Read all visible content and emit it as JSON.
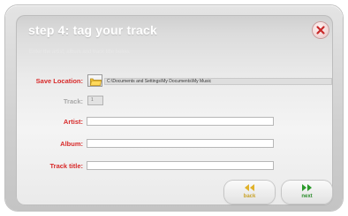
{
  "title": "step 4: tag your track",
  "subtitle": "Enter the artist, album and track title below.",
  "save_location": {
    "label": "Save Location:",
    "path": "C:\\Documents and Settings\\My Documents\\My Music"
  },
  "track": {
    "label": "Track:",
    "value": "1"
  },
  "fields": {
    "artist": {
      "label": "Artist:",
      "value": ""
    },
    "album": {
      "label": "Album:",
      "value": ""
    },
    "track_title": {
      "label": "Track title:",
      "value": ""
    }
  },
  "buttons": {
    "back": "back",
    "next": "next"
  },
  "colors": {
    "accent_red": "#d82a2a",
    "back_gold": "#c9a32a",
    "next_green": "#2f8f2f"
  },
  "icons": {
    "close": "close-icon",
    "folder": "folder-icon",
    "back": "rewind-icon",
    "next": "fast-forward-icon"
  }
}
